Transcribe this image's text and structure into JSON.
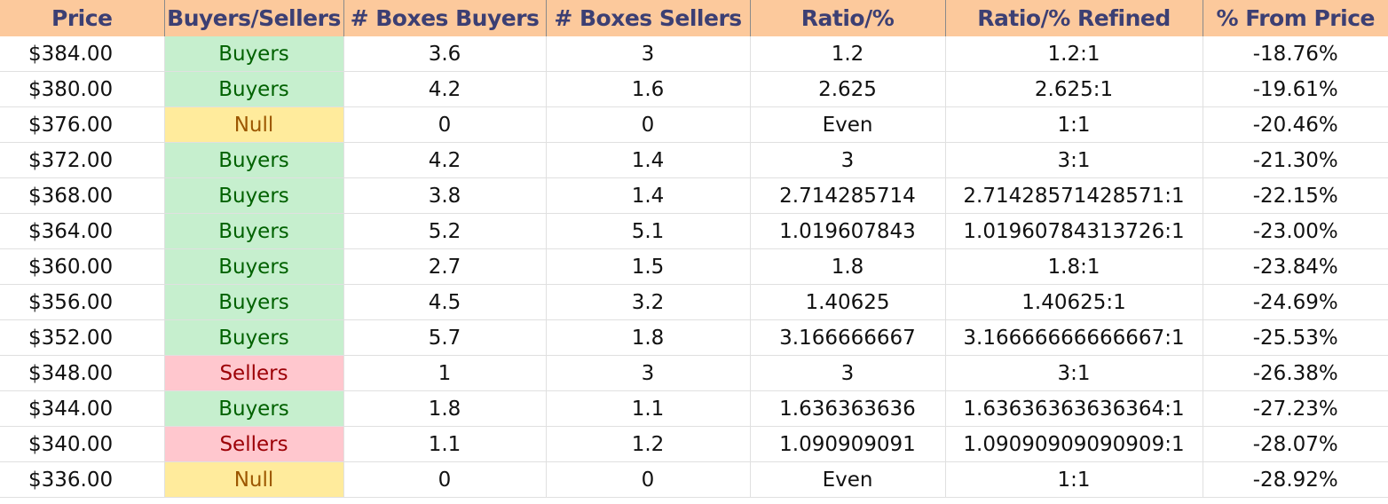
{
  "headers": [
    "Price",
    "Buyers/Sellers",
    "# Boxes Buyers",
    "# Boxes Sellers",
    "Ratio/%",
    "Ratio/% Refined",
    "% From Price"
  ],
  "colors": {
    "header_bg": "#fcc99c",
    "header_text": "#3c3f73",
    "buyers_bg": "#c6efce",
    "buyers_text": "#006100",
    "sellers_bg": "#ffc7ce",
    "sellers_text": "#9c0006",
    "null_bg": "#ffeb9c",
    "null_text": "#9c5700"
  },
  "rows": [
    {
      "price": "$384.00",
      "side": "Buyers",
      "boxes_buyers": "3.6",
      "boxes_sellers": "3",
      "ratio": "1.2",
      "ratio_refined": "1.2:1",
      "from_price": "-18.76%"
    },
    {
      "price": "$380.00",
      "side": "Buyers",
      "boxes_buyers": "4.2",
      "boxes_sellers": "1.6",
      "ratio": "2.625",
      "ratio_refined": "2.625:1",
      "from_price": "-19.61%"
    },
    {
      "price": "$376.00",
      "side": "Null",
      "boxes_buyers": "0",
      "boxes_sellers": "0",
      "ratio": "Even",
      "ratio_refined": "1:1",
      "from_price": "-20.46%"
    },
    {
      "price": "$372.00",
      "side": "Buyers",
      "boxes_buyers": "4.2",
      "boxes_sellers": "1.4",
      "ratio": "3",
      "ratio_refined": "3:1",
      "from_price": "-21.30%"
    },
    {
      "price": "$368.00",
      "side": "Buyers",
      "boxes_buyers": "3.8",
      "boxes_sellers": "1.4",
      "ratio": "2.714285714",
      "ratio_refined": "2.71428571428571:1",
      "from_price": "-22.15%"
    },
    {
      "price": "$364.00",
      "side": "Buyers",
      "boxes_buyers": "5.2",
      "boxes_sellers": "5.1",
      "ratio": "1.019607843",
      "ratio_refined": "1.01960784313726:1",
      "from_price": "-23.00%"
    },
    {
      "price": "$360.00",
      "side": "Buyers",
      "boxes_buyers": "2.7",
      "boxes_sellers": "1.5",
      "ratio": "1.8",
      "ratio_refined": "1.8:1",
      "from_price": "-23.84%"
    },
    {
      "price": "$356.00",
      "side": "Buyers",
      "boxes_buyers": "4.5",
      "boxes_sellers": "3.2",
      "ratio": "1.40625",
      "ratio_refined": "1.40625:1",
      "from_price": "-24.69%"
    },
    {
      "price": "$352.00",
      "side": "Buyers",
      "boxes_buyers": "5.7",
      "boxes_sellers": "1.8",
      "ratio": "3.166666667",
      "ratio_refined": "3.16666666666667:1",
      "from_price": "-25.53%"
    },
    {
      "price": "$348.00",
      "side": "Sellers",
      "boxes_buyers": "1",
      "boxes_sellers": "3",
      "ratio": "3",
      "ratio_refined": "3:1",
      "from_price": "-26.38%"
    },
    {
      "price": "$344.00",
      "side": "Buyers",
      "boxes_buyers": "1.8",
      "boxes_sellers": "1.1",
      "ratio": "1.636363636",
      "ratio_refined": "1.63636363636364:1",
      "from_price": "-27.23%"
    },
    {
      "price": "$340.00",
      "side": "Sellers",
      "boxes_buyers": "1.1",
      "boxes_sellers": "1.2",
      "ratio": "1.090909091",
      "ratio_refined": "1.09090909090909:1",
      "from_price": "-28.07%"
    },
    {
      "price": "$336.00",
      "side": "Null",
      "boxes_buyers": "0",
      "boxes_sellers": "0",
      "ratio": "Even",
      "ratio_refined": "1:1",
      "from_price": "-28.92%"
    }
  ]
}
